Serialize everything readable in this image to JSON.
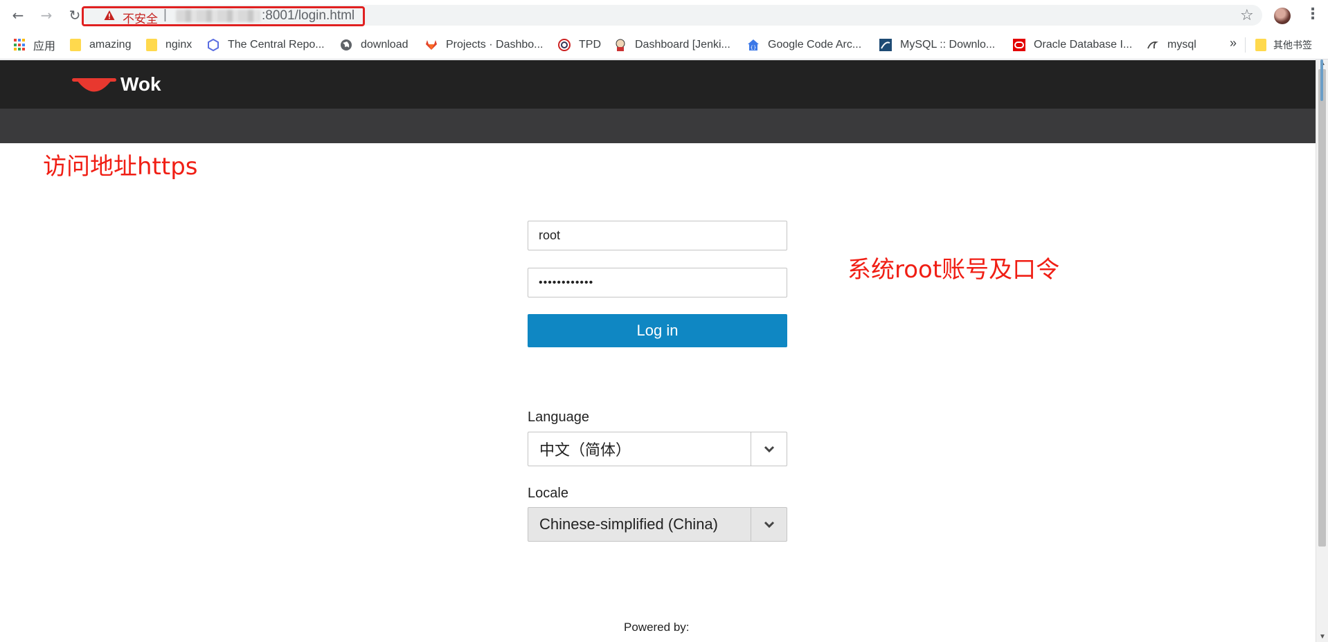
{
  "browser": {
    "address_bar": {
      "security_label": "不安全",
      "separator": "|",
      "url_visible": ":8001/login.html"
    },
    "bookmarks": [
      {
        "label": "应用",
        "icon": "apps-grid-icon"
      },
      {
        "label": "amazing",
        "icon": "folder-icon"
      },
      {
        "label": "nginx",
        "icon": "folder-icon"
      },
      {
        "label": "The Central Repo...",
        "icon": "hexagon-icon"
      },
      {
        "label": "download",
        "icon": "globe-icon"
      },
      {
        "label": "Projects · Dashbo...",
        "icon": "gitlab-icon"
      },
      {
        "label": "TPD",
        "icon": "tpd-icon"
      },
      {
        "label": "Dashboard [Jenki...",
        "icon": "jenkins-icon"
      },
      {
        "label": "Google Code Arc...",
        "icon": "google-code-icon"
      },
      {
        "label": "MySQL :: Downlo...",
        "icon": "mysql-icon"
      },
      {
        "label": "Oracle Database I...",
        "icon": "oracle-icon"
      },
      {
        "label": "mysql",
        "icon": "dolphin-icon"
      }
    ],
    "overflow_label": "»",
    "other_bookmarks": "其他书签"
  },
  "page": {
    "brand": "Wok",
    "annotations": {
      "url_note": "访问地址https",
      "cred_note": "系统root账号及口令"
    },
    "login": {
      "username_value": "root",
      "password_value": "••••••••••••",
      "button_label": "Log in"
    },
    "language": {
      "label": "Language",
      "selected": "中文（简体）"
    },
    "locale": {
      "label": "Locale",
      "selected": "Chinese-simplified (China)"
    },
    "footer": "Powered by:"
  },
  "colors": {
    "masthead": "#222222",
    "subbar": "#3a3a3c",
    "primary_button": "#0f87c3",
    "annotation_red": "#f01e14",
    "logo_red": "#e8382f"
  }
}
